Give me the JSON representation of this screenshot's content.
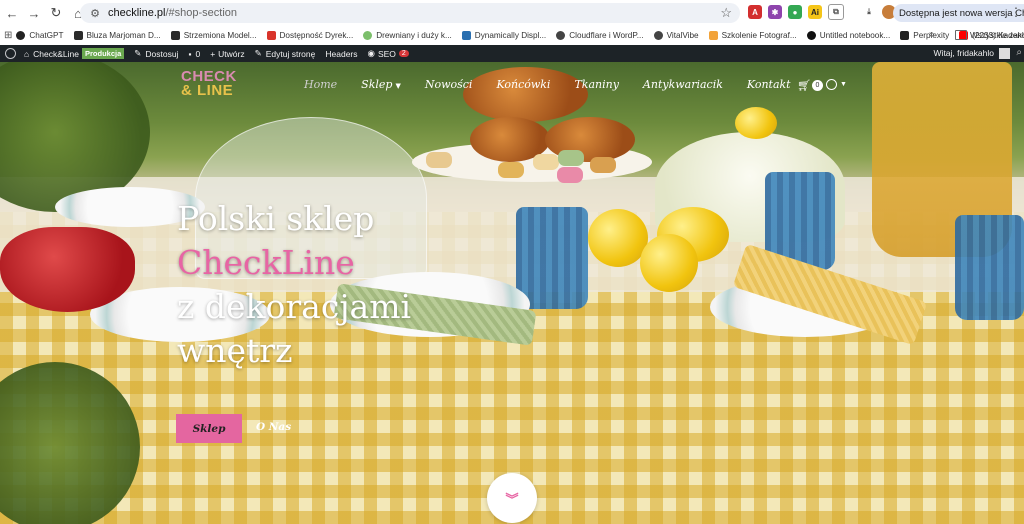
{
  "browser": {
    "url_domain": "checkline.pl",
    "url_path": "/#shop-section",
    "update_label": "Dostępna jest nowa wersja Chrome",
    "icons": [
      "back-icon",
      "forward-icon",
      "reload-icon",
      "home-icon",
      "tune-icon",
      "star-icon",
      "download-icon",
      "kebab-icon"
    ],
    "extensions": [
      {
        "name": "pdf-extension-icon",
        "color": "#d32f2f",
        "glyph": "A"
      },
      {
        "name": "purple-extension-icon",
        "color": "#8e44ad",
        "glyph": "✱"
      },
      {
        "name": "chrome-extension-icon",
        "color": "#34a853",
        "glyph": "●"
      },
      {
        "name": "ai-extension-icon",
        "color": "#f5c518",
        "glyph": "Ai"
      },
      {
        "name": "puzzle-icon",
        "color": "#777777",
        "glyph": "⧉"
      }
    ]
  },
  "bookmarks": {
    "items": [
      {
        "label": "ChatGPT",
        "color": "#222222"
      },
      {
        "label": "Bluza Marjoman D...",
        "color": "#2b2b2b"
      },
      {
        "label": "Strzemiona Model...",
        "color": "#2b2b2b"
      },
      {
        "label": "Dostępność Dyrek...",
        "color": "#d9342b"
      },
      {
        "label": "Drewniany i duży k...",
        "color": "#7cbf6b"
      },
      {
        "label": "Dynamically Displ...",
        "color": "#2a6fb0"
      },
      {
        "label": "Cloudflare i WordP...",
        "color": "#444444"
      },
      {
        "label": "VitalVibe",
        "color": "#444444"
      },
      {
        "label": "Szkolenie Fotograf...",
        "color": "#f2a33a"
      },
      {
        "label": "Untitled notebook...",
        "color": "#111111"
      },
      {
        "label": "Perplexity",
        "color": "#222222"
      },
      {
        "label": "(2233) Kadence S...",
        "color": "#ff0000"
      }
    ],
    "more": "»",
    "all_label": "Wszystkie zakładki"
  },
  "wpbar": {
    "site": "Check&Line",
    "env_badge": "Produkcja",
    "customize": "Dostosuj",
    "comments": "0",
    "new": "Utwórz",
    "edit": "Edytuj stronę",
    "headers": "Headers",
    "seo": "SEO",
    "seo_count": "2",
    "greeting": "Witaj, fridakahlo"
  },
  "site": {
    "logo_line1": "CHECK",
    "logo_line2": "& LINE",
    "nav": [
      {
        "label": "Home",
        "active": true
      },
      {
        "label": "Sklep",
        "has_dropdown": true
      },
      {
        "label": "Nowości"
      },
      {
        "label": "Końcówki"
      },
      {
        "label": "Tkaniny"
      },
      {
        "label": "Antykwariacik"
      },
      {
        "label": "Kontakt"
      }
    ],
    "cart_count": "0",
    "hero_line1": "Polski sklep",
    "hero_line2": "CheckLine",
    "hero_line3": "z dekoracjami",
    "hero_line4": "wnętrz",
    "btn_shop": "Sklep",
    "btn_about": "O Nas",
    "scroll_icon": "chevrons-down-icon"
  }
}
